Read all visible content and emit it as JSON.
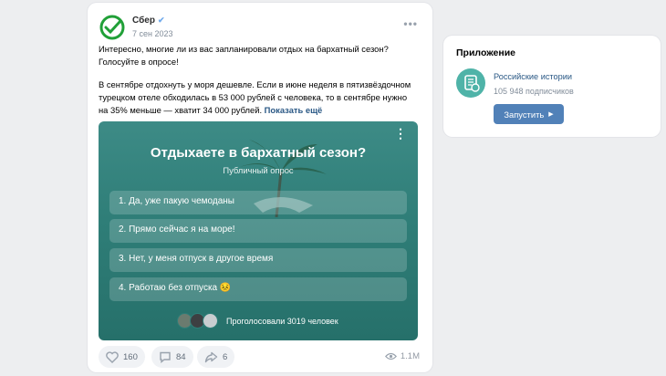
{
  "post": {
    "author": "Сбер",
    "date": "7 сен 2023",
    "paragraph1": "Интересно, многие ли из вас запланировали отдых на бархатный сезон? Голосуйте в опросе!",
    "paragraph2": "В сентябре отдохнуть у моря дешевле. Если в июне неделя в пятизвёздочном турецком отеле обходилась в 53 000 рублей с человека, то в сентябре нужно на 35% меньше — хватит 34 000 рублей.",
    "show_more": "Показать ещё",
    "likes": "160",
    "comments": "84",
    "shares": "6",
    "views": "1.1M"
  },
  "poll": {
    "title": "Отдыхаете в бархатный сезон?",
    "subtitle": "Публичный опрос",
    "options": [
      "1. Да, уже пакую чемоданы",
      "2. Прямо сейчас я на море!",
      "3. Нет, у меня отпуск в другое время",
      "4. Работаю без отпуска 😣"
    ],
    "voted": "Проголосовали 3019 человек"
  },
  "app": {
    "heading": "Приложение",
    "name": "Российские истории",
    "subscribers": "105 948 подписчиков",
    "launch": "Запустить"
  },
  "colors": {
    "brand_green": "#21a038",
    "poll_bg": "#2f7e78",
    "link": "#2a5885",
    "button": "#5181b8"
  },
  "icons": [
    "sber-logo-icon",
    "verified-icon",
    "more-icon",
    "heart-icon",
    "comment-icon",
    "share-icon",
    "eye-icon",
    "app-logo-icon",
    "play-icon"
  ]
}
